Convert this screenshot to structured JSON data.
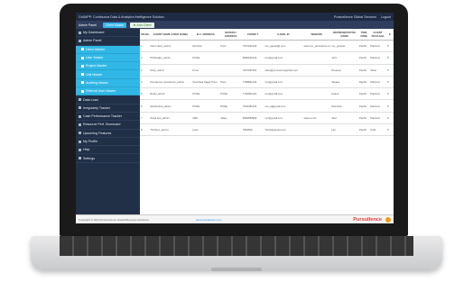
{
  "app": {
    "title": "GrAMPP: Continuous Data & Analytics Intelligence Solution",
    "topbar_right": [
      "Pursuellence Global Services",
      "Logout"
    ],
    "breadcrumb": "Admin Panel",
    "tab_primary": "Client Master",
    "tab_add": "Add Client"
  },
  "sidebar": {
    "items": [
      {
        "label": "My Dashboard",
        "sub": false
      },
      {
        "label": "Admin Panel",
        "sub": false
      },
      {
        "label": "Client Master",
        "sub": true
      },
      {
        "label": "User Master",
        "sub": true
      },
      {
        "label": "Project Master",
        "sub": true
      },
      {
        "label": "Unit Master",
        "sub": true
      },
      {
        "label": "Auditing Master",
        "sub": true
      },
      {
        "label": "Referral User Master",
        "sub": true
      },
      {
        "label": "Data Load",
        "sub": false
      },
      {
        "label": "Irregularity Tracker",
        "sub": false
      },
      {
        "label": "Cash Performance Tracker",
        "sub": false
      },
      {
        "label": "Resource Perf. Scorecard",
        "sub": false
      },
      {
        "label": "Upcoming Features",
        "sub": false
      },
      {
        "label": "My Profile",
        "sub": false
      },
      {
        "label": "Help",
        "sub": false
      },
      {
        "label": "Settings",
        "sub": false
      }
    ]
  },
  "table": {
    "columns": [
      "SR.NO.",
      "CLIENT NAME (USER NAME)",
      "B.U. ADDRESS",
      "BRANCH ADDRESS",
      "PHONE #",
      "E-MAIL ID",
      "WEBSITE",
      "REPRESENTATIVE NAME",
      "TIME ZONE",
      "CLIENT PACKAGE",
      "E"
    ],
    "rows": [
      [
        "1",
        "client client_admin",
        "Mumbai",
        "Pune",
        "7507041234",
        "xxx_gamail@.com",
        "www.xxx_pursulence.com",
        "xxx_pursule",
        "Pacific",
        "Platinum",
        "✎"
      ],
      [
        "2",
        "PSIGwgbe_admin",
        "PUNE",
        "",
        "9890640123",
        "xxx@gmail.com",
        "",
        "John",
        "Pacific",
        "Platinum",
        "✎"
      ],
      [
        "3",
        "Shop_admin",
        "Pune",
        "",
        "7007087391",
        "client@pursulenceglobal.com",
        "",
        "Dreamer",
        "Pacific",
        "Silver",
        "✎"
      ],
      [
        "4",
        "Pursulence pursulence_admin",
        "Sambhaji Nagar Pune",
        "Pune",
        "7768861234",
        "xxx@gmail.com",
        "",
        "Tapase",
        "Pacific",
        "Platinum",
        "✎"
      ],
      [
        "5",
        "Rahul_admin",
        "PUNE",
        "PUNE",
        "7760901123",
        "xxx@gmail.com",
        "",
        "Anand",
        "Pacific",
        "Platinum",
        "✎"
      ],
      [
        "6",
        "SHAGrobal_admin",
        "PUNE",
        "PUNE",
        "7040481234",
        "xxx_a@gmail.com",
        "",
        "Navindra",
        "Pacific",
        "Platinum",
        "✎"
      ],
      [
        "7",
        "Swati test_admin",
        "NEP",
        "Jaltoy",
        "9966583999",
        "xyz@gmail.com",
        "www.a.com",
        "Jiten",
        "Pacific",
        "Platinum",
        "✎"
      ],
      [
        "8",
        "TSChem_admin",
        "pune",
        "",
        "7653650",
        "TSCH@gmail.com",
        "",
        "Lan",
        "Pacific",
        "Gold",
        "✎"
      ]
    ]
  },
  "footer": {
    "copyright": "Copyright © 2016 PursueVence Global Business Solutions.",
    "website": "www.pursulence.com",
    "brand": "Pursullence"
  }
}
